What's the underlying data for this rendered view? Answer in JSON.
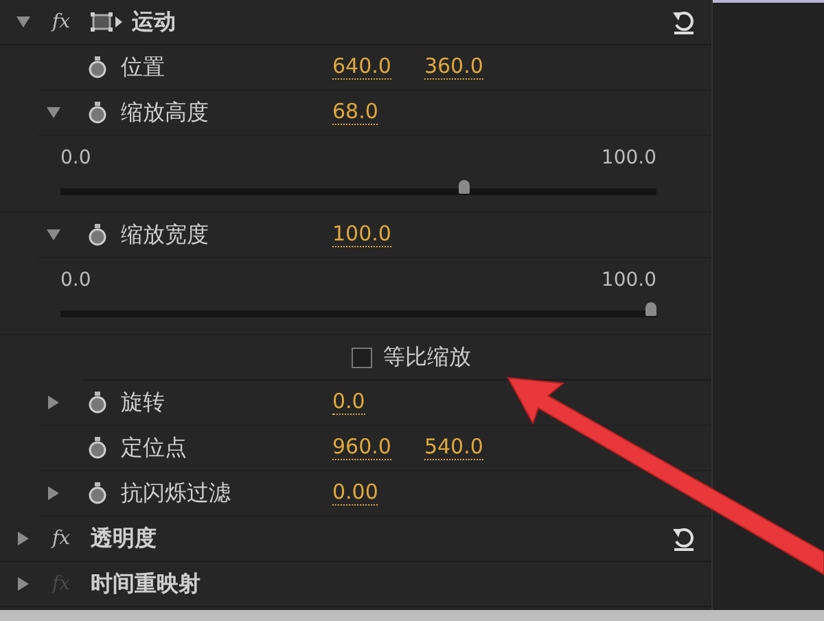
{
  "rows": [
    {
      "kind": "effect",
      "badge": "fx",
      "badge_enabled": true,
      "motion_icon": true,
      "name": "运动",
      "expanded": true,
      "resettable": true
    },
    {
      "kind": "property",
      "expandable": false,
      "name": "位置",
      "values": [
        "640.0",
        "360.0"
      ]
    },
    {
      "kind": "property",
      "expandable": true,
      "expanded": true,
      "name": "缩放高度",
      "values": [
        "68.0"
      ]
    },
    {
      "kind": "slider",
      "min": "0.0",
      "max": "100.0",
      "level": 0.68
    },
    {
      "kind": "property",
      "expandable": true,
      "expanded": true,
      "name": "缩放宽度",
      "values": [
        "100.0"
      ]
    },
    {
      "kind": "slider",
      "min": "0.0",
      "max": "100.0",
      "level": 1.0
    },
    {
      "kind": "checkbox",
      "label": "等比缩放",
      "checked": false
    },
    {
      "kind": "property",
      "expandable": true,
      "expanded": false,
      "name": "旋转",
      "values": [
        "0.0"
      ]
    },
    {
      "kind": "property",
      "expandable": false,
      "name": "定位点",
      "values": [
        "960.0",
        "540.0"
      ]
    },
    {
      "kind": "property",
      "expandable": true,
      "expanded": false,
      "name": "抗闪烁过滤",
      "values": [
        "0.00"
      ]
    },
    {
      "kind": "effect",
      "badge": "fx",
      "badge_enabled": true,
      "motion_icon": false,
      "name": "透明度",
      "expanded": false,
      "resettable": true
    },
    {
      "kind": "effect",
      "badge": "fx",
      "badge_enabled": false,
      "motion_icon": false,
      "name": "时间重映射",
      "expanded": false,
      "resettable": false
    }
  ],
  "annotation": {
    "kind": "arrow"
  }
}
